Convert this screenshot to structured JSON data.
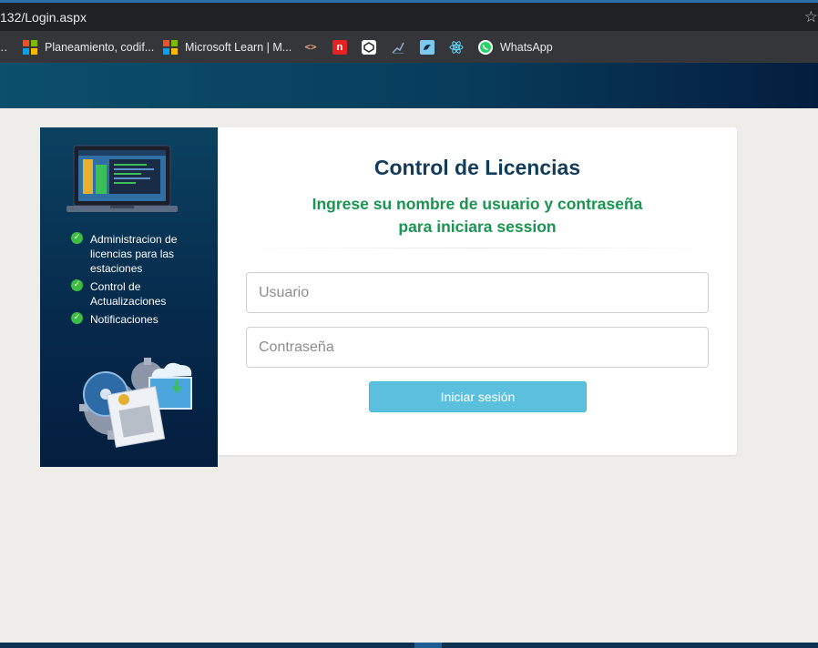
{
  "browser": {
    "url": "132/Login.aspx",
    "bookmarks": [
      {
        "label": "Planeamiento, codif...",
        "icon": "microsoft-icon"
      },
      {
        "label": "Microsoft Learn | M...",
        "icon": "microsoft-icon"
      },
      {
        "label": "",
        "icon": "code-icon"
      },
      {
        "label": "",
        "icon": "red-n-icon"
      },
      {
        "label": "",
        "icon": "cube-icon"
      },
      {
        "label": "",
        "icon": "chart-icon"
      },
      {
        "label": "",
        "icon": "bird-icon"
      },
      {
        "label": "",
        "icon": "react-icon"
      },
      {
        "label": "WhatsApp",
        "icon": "whatsapp-icon"
      }
    ]
  },
  "sidebar": {
    "features": [
      "Administracion de licencias para las estaciones",
      "Control de Actualizaciones",
      "Notificaciones"
    ]
  },
  "login": {
    "title": "Control de Licencias",
    "subtitle": "Ingrese su nombre de usuario y contraseña para iniciara session",
    "username_placeholder": "Usuario",
    "password_placeholder": "Contraseña",
    "submit_label": "Iniciar sesión"
  },
  "colors": {
    "title": "#123c5a",
    "subtitle": "#1a9450",
    "button": "#5bc0de",
    "panel": "#062a4c"
  }
}
